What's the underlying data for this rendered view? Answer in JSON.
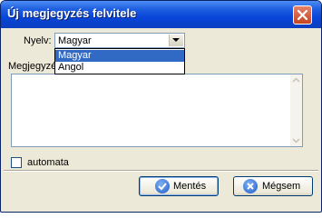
{
  "window": {
    "title": "Új megjegyzés felvitele"
  },
  "form": {
    "language_label": "Nyelv:",
    "language_value": "Magyar",
    "language_options": [
      "Magyar",
      "Angol"
    ],
    "note_label": "Megjegyzé",
    "auto_label": "automata"
  },
  "buttons": {
    "save_label": "Mentés",
    "cancel_label": "Mégsem"
  },
  "colors": {
    "titlebar": "#0845d8",
    "selection": "#316ac5",
    "face": "#ece9d8",
    "close": "#c44520"
  }
}
